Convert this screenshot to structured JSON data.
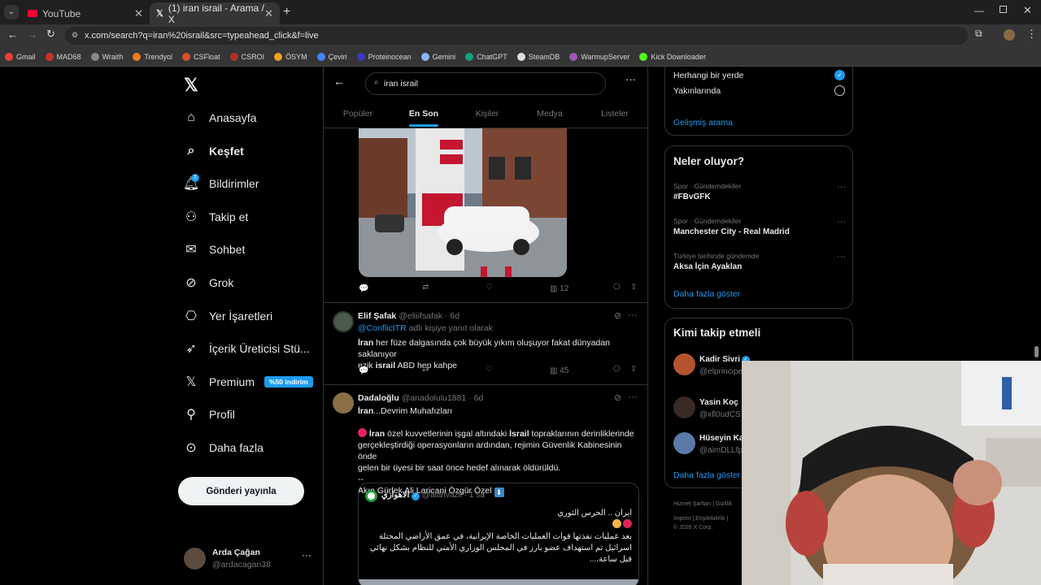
{
  "browser": {
    "tabs": [
      {
        "title": "YouTube",
        "active": false
      },
      {
        "title": "(1) iran israil - Arama / X",
        "active": true
      }
    ],
    "url": "x.com/search?q=iran%20israil&src=typeahead_click&f=live",
    "bookmarks": [
      "Gmail",
      "MAD68",
      "Wraith",
      "Trendyol",
      "CSFloat",
      "CSROI",
      "ÖSYM",
      "Çeviri",
      "Proteinocean",
      "Gemini",
      "ChatGPT",
      "SteamDB",
      "WarmupServer",
      "Kick Downloader"
    ]
  },
  "sidebar": {
    "items": [
      {
        "label": "Anasayfa",
        "icon": "home-icon"
      },
      {
        "label": "Keşfet",
        "icon": "search-icon"
      },
      {
        "label": "Bildirimler",
        "icon": "bell-icon",
        "badge": "1"
      },
      {
        "label": "Takip et",
        "icon": "person-plus-icon"
      },
      {
        "label": "Sohbet",
        "icon": "mail-icon"
      },
      {
        "label": "Grok",
        "icon": "grok-icon"
      },
      {
        "label": "Yer İşaretleri",
        "icon": "bookmark-icon"
      },
      {
        "label": "İçerik Üreticisi Stü...",
        "icon": "rocket-icon"
      },
      {
        "label": "Premium",
        "icon": "x-logo-icon",
        "badge": "%50 indirim"
      },
      {
        "label": "Profil",
        "icon": "user-icon"
      },
      {
        "label": "Daha fazla",
        "icon": "more-circle-icon"
      }
    ],
    "post_button": "Gönderi yayınla",
    "user": {
      "name": "Arda Çağan",
      "handle": "@ardacagan38"
    }
  },
  "search": {
    "query": "iran israil",
    "tabs": [
      "Popüler",
      "En Son",
      "Kişiler",
      "Medya",
      "Listeler"
    ],
    "active_tab": "En Son"
  },
  "tweets": [
    {
      "views": "12"
    },
    {
      "name": "Elif Şafak",
      "handle": "@eliiifsafak",
      "time": "6d",
      "reply_to": "@ConflictTR",
      "reply_suffix": "adlı kişiye yanıt olarak",
      "line1_bold": "İran",
      "line1_rest": " her füze dalgasında çok büyük  yıkım oluşuyor fakat dünyadan saklanıyor",
      "line2_pre": "ezik ",
      "line2_bold": "israil",
      "line2_rest": " ABD  hep kahpe",
      "views": "45"
    },
    {
      "name": "Dadaloğlu",
      "handle": "@anadolulu1881",
      "time": "6d",
      "line1_bold": "İran",
      "line1_rest": "...Devrim Muhafızları",
      "p2_bold1": "İran",
      "p2_mid": " özel kuvvetlerinin işgal altındaki ",
      "p2_bold2": "İsrail",
      "p2_rest": " topraklarının derinliklerinde",
      "p2_line2": "gerçekleştirdiği operasyonların ardından, rejimin Güvenlik Kabinesinin önde",
      "p2_line3": "gelen bir üyesi bir saat önce hedef alınarak öldürüldü.",
      "dashes": "--",
      "footer": "Akın Gürlek Ali Laricani Özgür Özel",
      "quote": {
        "name": "الاهوازي",
        "handle": "@alahvazii",
        "time": "1 sa",
        "line1": "ايران .. الحرس الثوري",
        "line2": "بعد عمليات نفذتها قوات العمليات الخاصة الإيرانية، في عمق الأراضي المحتلة",
        "line3": "اسرائيل تم استهداف عضو بارز في المجلس الوزاري الأمني للنظام بشكل نهائي",
        "line4": "قبل ساعة...."
      }
    }
  ],
  "right": {
    "location_options": [
      "Herhangi bir yerde",
      "Yakınlarında"
    ],
    "advanced_search": "Gelişmiş arama",
    "trends_title": "Neler oluyor?",
    "trends": [
      {
        "meta": "Spor · Gündemdekiler",
        "title": "#FBvGFK"
      },
      {
        "meta": "Spor · Gündemdekiler",
        "title": "Manchester City - Real Madrid"
      },
      {
        "meta": "Türkiye tarihinde gündemde",
        "title": "Aksa İçin Ayaklan"
      }
    ],
    "show_more": "Daha fazla göster",
    "follow_title": "Kimi takip etmeli",
    "suggestions": [
      {
        "name": "Kadir Sivri",
        "handle": "@elprincipe"
      },
      {
        "name": "Yasin Koç",
        "handle": "@xfl0udCS"
      },
      {
        "name": "Hüseyin Ka",
        "handle": "@aimDLLfp"
      }
    ],
    "follow_show_more": "Daha fazla göster",
    "footer_line1": "Hizmet Şartları  |  Gizlilik",
    "footer_line2": "İmprint  |  Erişilebilirlik  |",
    "footer_line3": "© 2026 X Corp."
  },
  "colors": {
    "accent": "#1d9bf0",
    "background": "#000000",
    "border": "#2f3336",
    "muted": "#71767b"
  }
}
